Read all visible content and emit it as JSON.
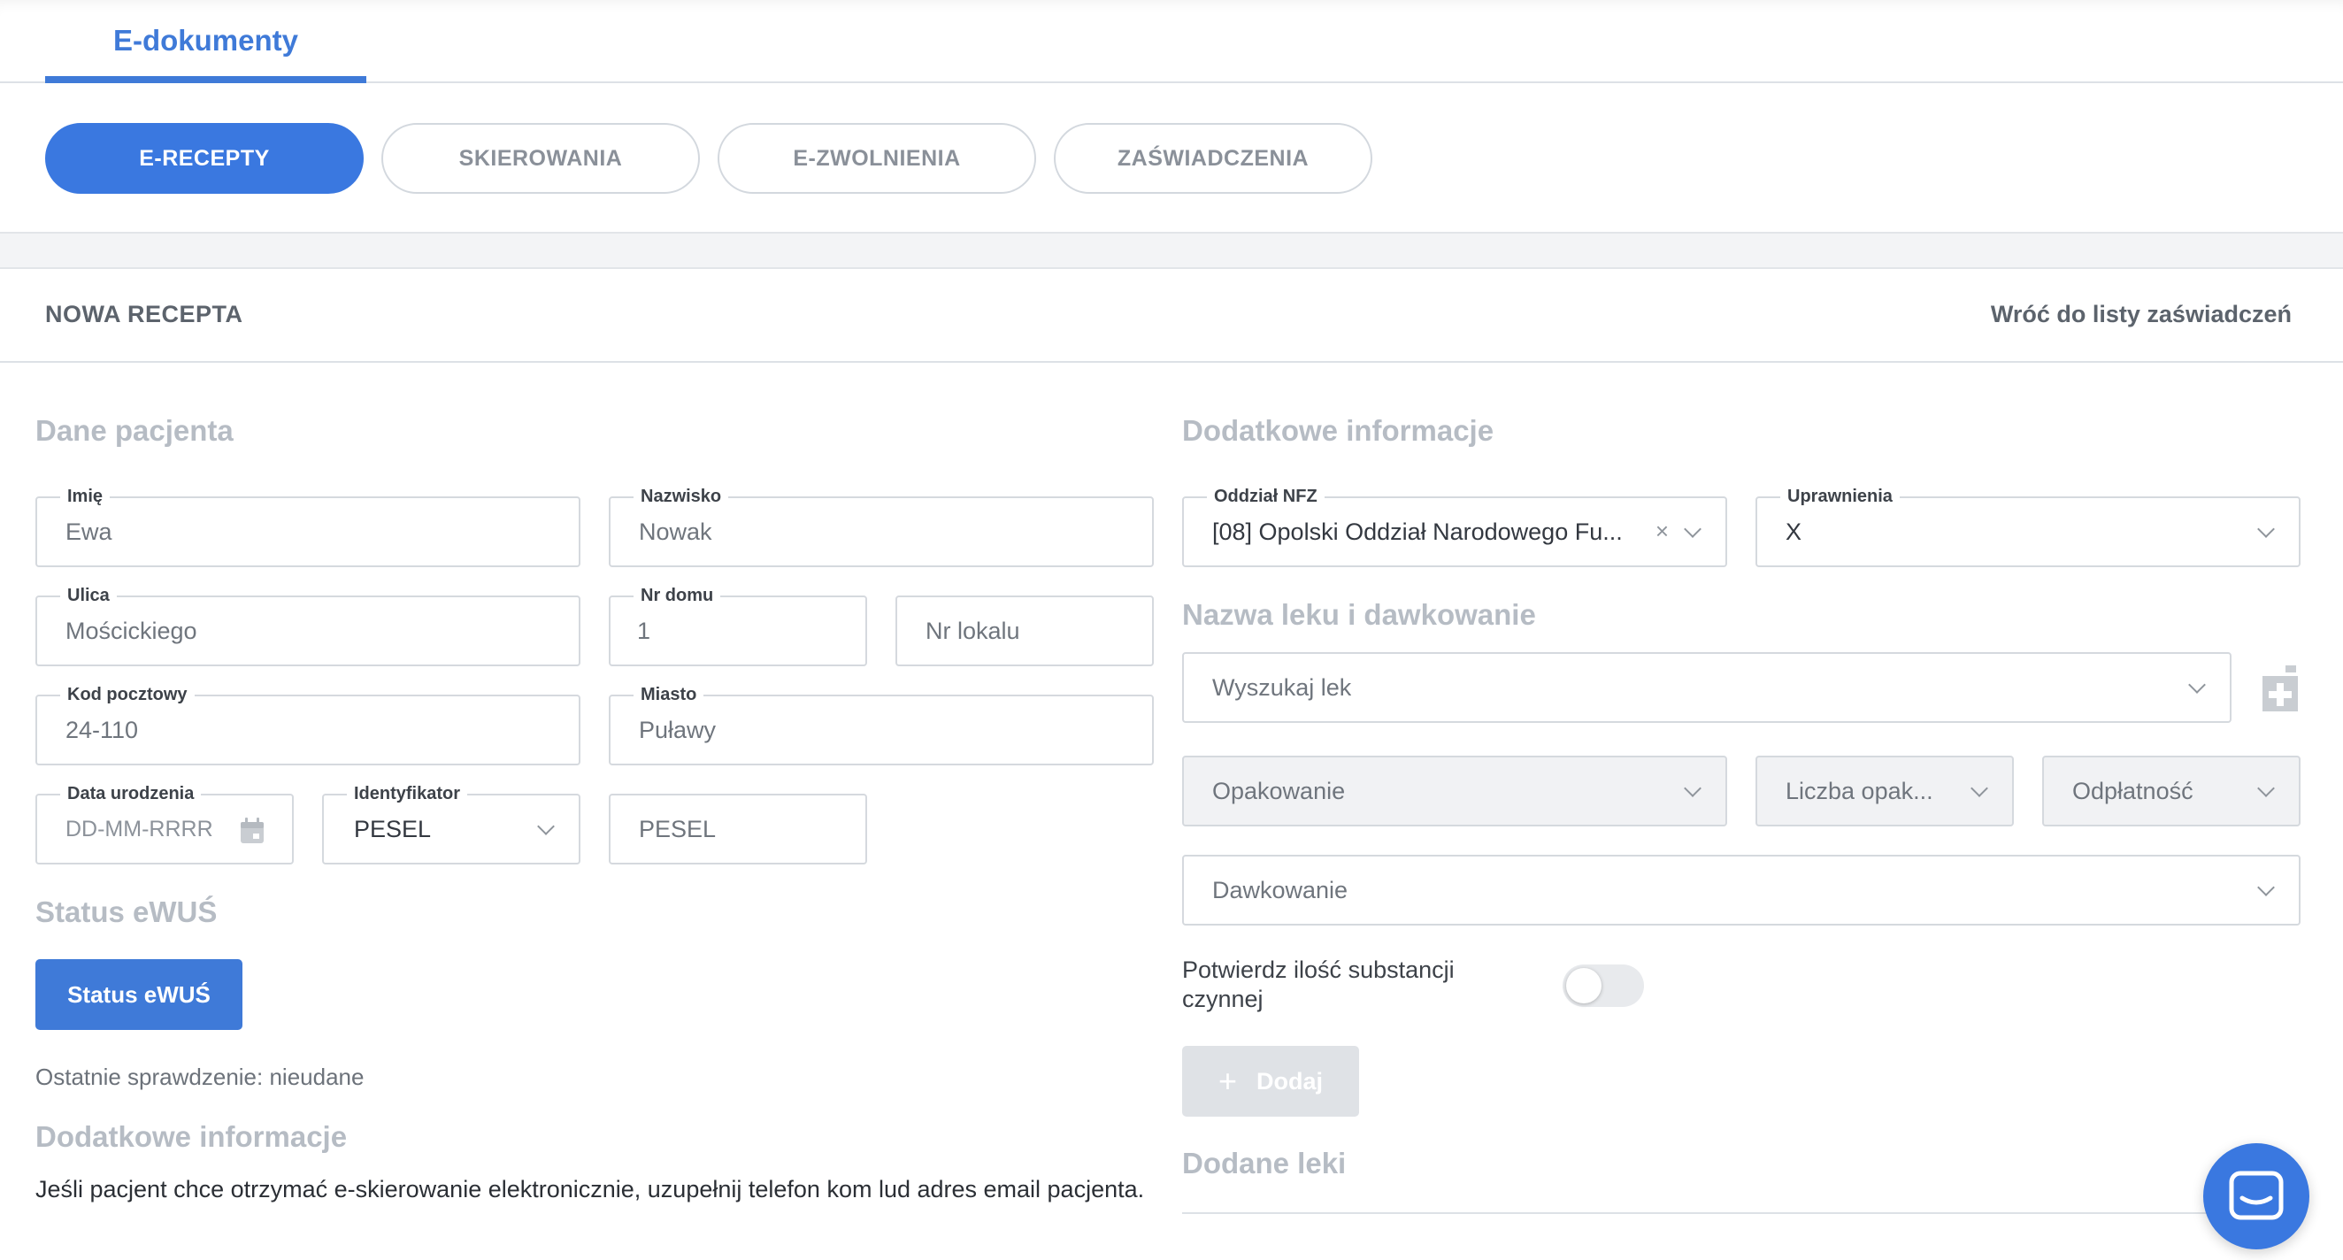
{
  "header": {
    "main_tab": "E-dokumenty"
  },
  "doc_tabs": [
    {
      "label": "E-RECEPTY",
      "active": true
    },
    {
      "label": "SKIEROWANIA",
      "active": false
    },
    {
      "label": "E-ZWOLNIENIA",
      "active": false
    },
    {
      "label": "ZAŚWIADCZENIA",
      "active": false
    }
  ],
  "section": {
    "title": "NOWA RECEPTA",
    "back_link": "Wróć do listy zaświadczeń"
  },
  "patient": {
    "heading": "Dane pacjenta",
    "first_name": {
      "label": "Imię",
      "value": "Ewa"
    },
    "last_name": {
      "label": "Nazwisko",
      "value": "Nowak"
    },
    "street": {
      "label": "Ulica",
      "value": "Mościckiego"
    },
    "house_no": {
      "label": "Nr domu",
      "value": "1"
    },
    "flat_no": {
      "placeholder": "Nr lokalu"
    },
    "postal_code": {
      "label": "Kod pocztowy",
      "value": "24-110"
    },
    "city": {
      "label": "Miasto",
      "value": "Puławy"
    },
    "birth_date": {
      "label": "Data urodzenia",
      "placeholder": "DD-MM-RRRR"
    },
    "identifier": {
      "label": "Identyfikator",
      "value": "PESEL"
    },
    "pesel": {
      "placeholder": "PESEL"
    }
  },
  "ewus": {
    "heading": "Status eWUŚ",
    "button": "Status eWUŚ",
    "last_check": "Ostatnie sprawdzenie: nieudane"
  },
  "extra_info_left": {
    "heading": "Dodatkowe informacje",
    "text": "Jeśli pacjent chce otrzymać e-skierowanie elektronicznie, uzupełnij telefon kom lud adres email pacjenta."
  },
  "extra_info_right": {
    "heading": "Dodatkowe informacje",
    "nfz": {
      "label": "Oddział NFZ",
      "value": "[08] Opolski Oddział Narodowego Fu..."
    },
    "entitlements": {
      "label": "Uprawnienia",
      "value": "X"
    }
  },
  "drug": {
    "heading": "Nazwa leku i dawkowanie",
    "search_placeholder": "Wyszukaj lek",
    "package_placeholder": "Opakowanie",
    "package_count_placeholder": "Liczba opak...",
    "payment_placeholder": "Odpłatność",
    "dosage_placeholder": "Dawkowanie",
    "confirm_label": "Potwierdz ilość substancji czynnej",
    "confirm_on": false,
    "add_button": "Dodaj",
    "added_heading": "Dodane leki"
  },
  "icons": {
    "calendar": "calendar-icon",
    "prescription_add": "prescription-add-icon",
    "chat": "chat-icon"
  },
  "colors": {
    "accent": "#3a78e0",
    "heading_muted": "#b6bcc4",
    "disabled_button": "#dfe2e6"
  }
}
